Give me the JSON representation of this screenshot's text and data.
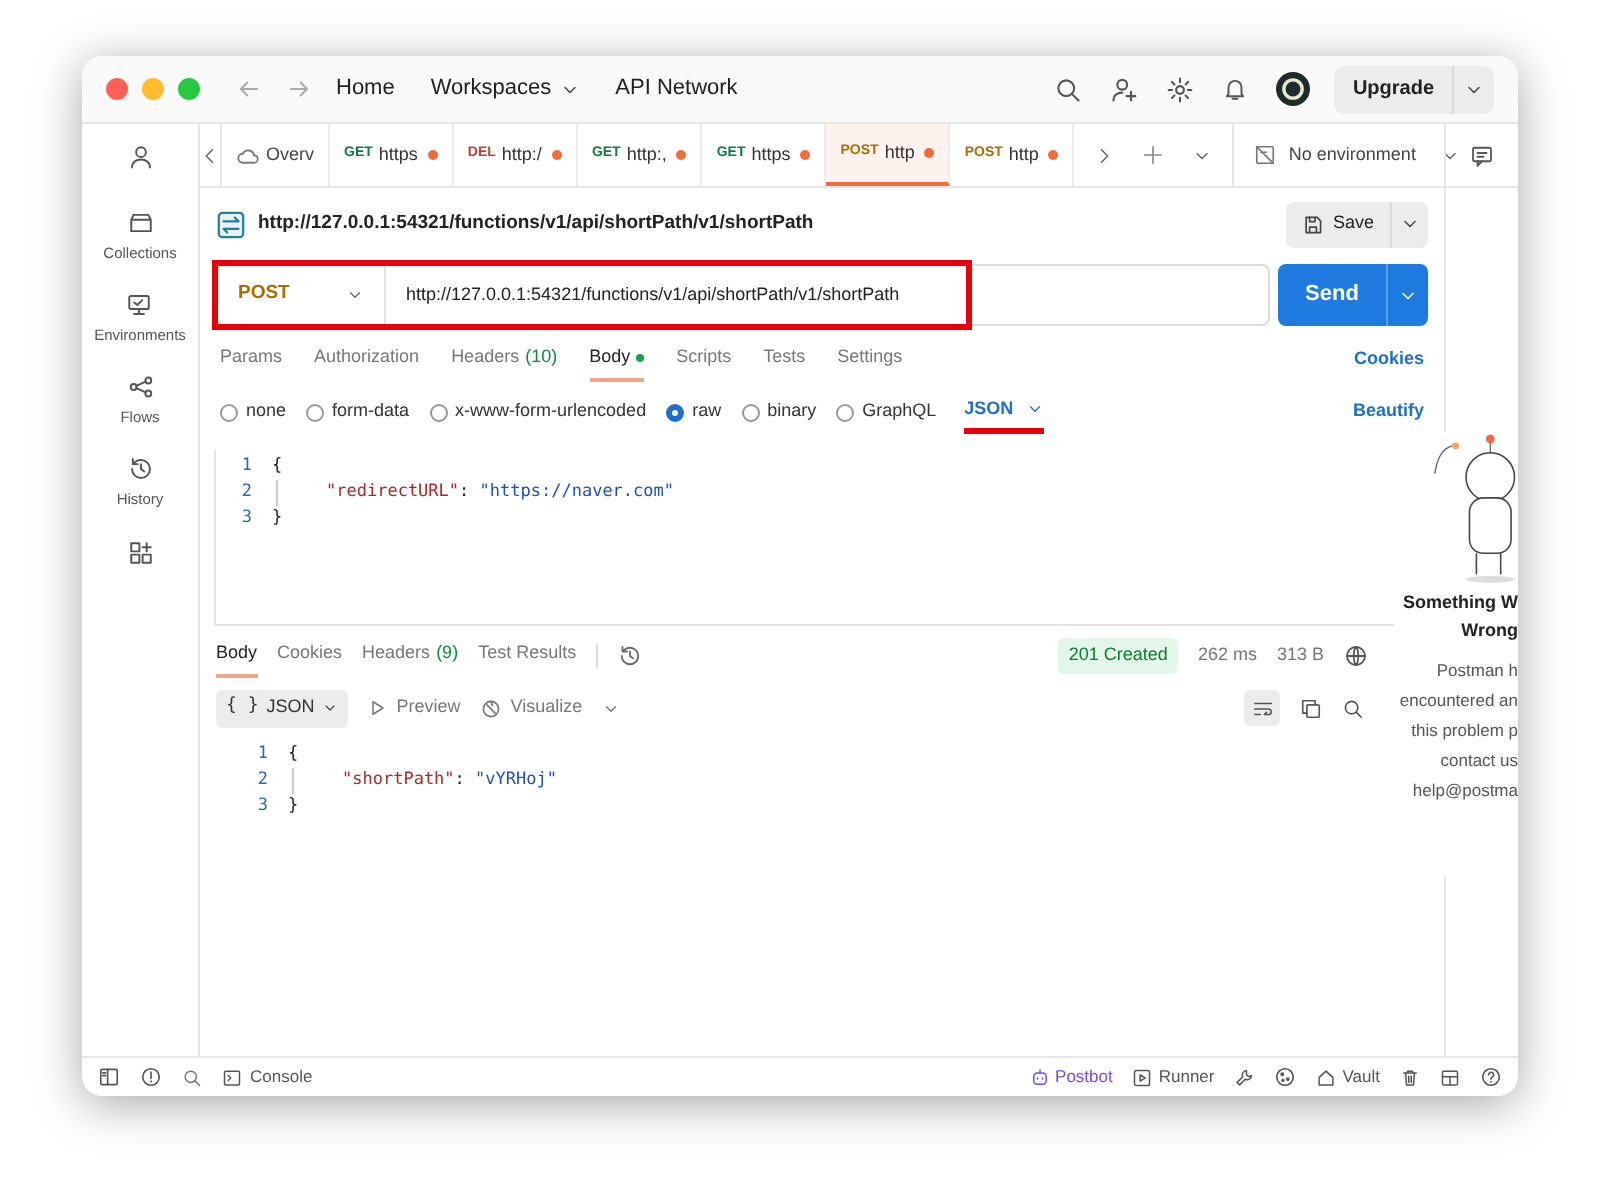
{
  "nav": [
    {
      "kind": "link",
      "label": "Home"
    },
    {
      "kind": "menu",
      "label": "Workspaces"
    },
    {
      "kind": "link",
      "label": "API Network"
    }
  ],
  "upgrade_button": "Upgrade",
  "sidebar": [
    {
      "kind": "collections",
      "label": "Collections"
    },
    {
      "kind": "environments",
      "label": "Environments"
    },
    {
      "kind": "flows",
      "label": "Flows"
    },
    {
      "kind": "history",
      "label": "History"
    }
  ],
  "tabs": [
    {
      "kind": "overview",
      "label": "Overv",
      "unsaved": false,
      "selected": false
    },
    {
      "kind": "get",
      "method": "GET",
      "label": "https",
      "unsaved": true,
      "selected": false
    },
    {
      "kind": "delete",
      "method": "DEL",
      "label": "http:/",
      "unsaved": true,
      "selected": false
    },
    {
      "kind": "get",
      "method": "GET",
      "label": "http:,",
      "unsaved": true,
      "selected": false
    },
    {
      "kind": "get",
      "method": "GET",
      "label": "https",
      "unsaved": true,
      "selected": false
    },
    {
      "kind": "post",
      "method": "POST",
      "label": "http",
      "unsaved": true,
      "selected": true
    },
    {
      "kind": "post",
      "method": "POST",
      "label": "http",
      "unsaved": true,
      "selected": false
    }
  ],
  "environment": "No environment",
  "request": {
    "title": "http://127.0.0.1:54321/functions/v1/api/shortPath/v1/shortPath",
    "save_button": "Save",
    "method": "POST",
    "url": "http://127.0.0.1:54321/functions/v1/api/shortPath/v1/shortPath",
    "highlighted": true,
    "send_button": "Send"
  },
  "request_tabs": [
    {
      "label": "Params",
      "selected": false
    },
    {
      "label": "Authorization",
      "selected": false
    },
    {
      "label": "Headers",
      "count": "(10)",
      "selected": false
    },
    {
      "label": "Body",
      "dot": true,
      "selected": true
    },
    {
      "label": "Scripts",
      "selected": false
    },
    {
      "label": "Tests",
      "selected": false
    },
    {
      "label": "Settings",
      "selected": false
    }
  ],
  "cookies_link": "Cookies",
  "body_types": [
    {
      "label": "none",
      "selected": false
    },
    {
      "label": "form-data",
      "selected": false
    },
    {
      "label": "x-www-form-urlencoded",
      "selected": false
    },
    {
      "label": "raw",
      "selected": true
    },
    {
      "label": "binary",
      "selected": false
    },
    {
      "label": "GraphQL",
      "selected": false
    }
  ],
  "body_format": {
    "label": "JSON",
    "underlined": true
  },
  "beautify_link": "Beautify",
  "request_body": [
    {
      "number": "1",
      "indented": false,
      "tokens": [
        {
          "kind": "punct",
          "text": "{"
        }
      ]
    },
    {
      "number": "2",
      "indented": true,
      "tokens": [
        {
          "kind": "key",
          "text": "\"redirectURL\""
        },
        {
          "kind": "punct",
          "text": ": "
        },
        {
          "kind": "string",
          "text": "\"https://naver.com\""
        }
      ]
    },
    {
      "number": "3",
      "indented": false,
      "tokens": [
        {
          "kind": "punct",
          "text": "}"
        }
      ]
    }
  ],
  "response": {
    "tabs": [
      {
        "label": "Body",
        "selected": true
      },
      {
        "label": "Cookies",
        "selected": false
      },
      {
        "label": "Headers",
        "count": "(9)",
        "selected": false
      },
      {
        "label": "Test Results",
        "selected": false
      }
    ],
    "status": "201 Created",
    "time": "262 ms",
    "size": "313 B",
    "format_glyph": "{ }",
    "format": "JSON",
    "preview": "Preview",
    "visualize": "Visualize",
    "body": [
      {
        "number": "1",
        "indented": false,
        "tokens": [
          {
            "kind": "punct",
            "text": "{"
          }
        ]
      },
      {
        "number": "2",
        "indented": true,
        "tokens": [
          {
            "kind": "key",
            "text": "\"shortPath\""
          },
          {
            "kind": "punct",
            "text": ": "
          },
          {
            "kind": "string",
            "text": "\"vYRHoj\""
          }
        ]
      },
      {
        "number": "3",
        "indented": false,
        "tokens": [
          {
            "kind": "punct",
            "text": "}"
          }
        ]
      }
    ]
  },
  "error_panel": {
    "title_lines": [
      "Something W",
      "Wrong"
    ],
    "message_lines": [
      "Postman h",
      "encountered an",
      "this problem p",
      "contact us",
      "help@postma"
    ]
  },
  "status_bar": {
    "console": "Console",
    "items": [
      {
        "kind": "postbot",
        "label": "Postbot"
      },
      {
        "kind": "runner",
        "label": "Runner"
      },
      {
        "kind": "vault",
        "label": "Vault"
      }
    ]
  }
}
